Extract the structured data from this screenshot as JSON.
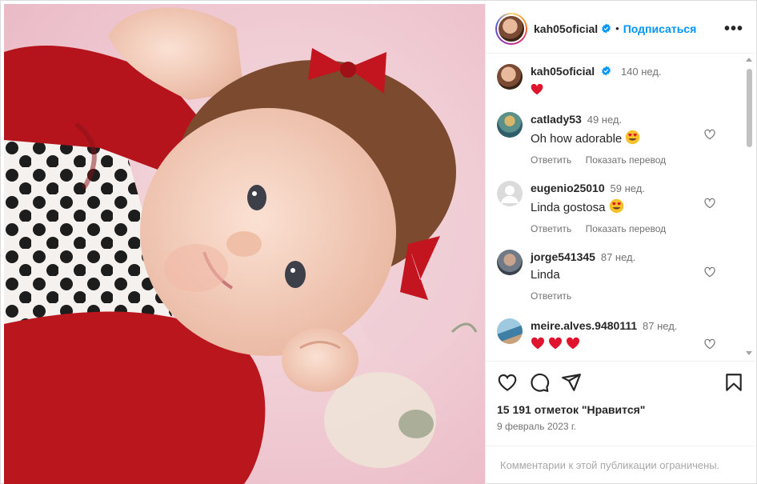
{
  "post": {
    "username": "kah05oficial",
    "follow_label": "Подписаться",
    "dot": "•",
    "more": "•••"
  },
  "caption": {
    "username": "kah05oficial",
    "time": "140 нед."
  },
  "comments": [
    {
      "username": "catlady53",
      "time": "49 нед.",
      "text": "Oh how adorable",
      "reply": "Ответить",
      "translate": "Показать перевод"
    },
    {
      "username": "eugenio25010",
      "time": "59 нед.",
      "text": "Linda gostosa",
      "reply": "Ответить",
      "translate": "Показать перевод"
    },
    {
      "username": "jorge541345",
      "time": "87 нед.",
      "text": "Linda",
      "reply": "Ответить"
    },
    {
      "username": "meire.alves.9480111",
      "time": "87 нед."
    }
  ],
  "likes": "15 191 отметок \"Нравится\"",
  "date": "9 февраль 2023 г.",
  "restricted": "Комментарии к этой публикации ограничены.",
  "icons": {
    "more": "more-horizontal-icon",
    "verified": "verified-badge-icon",
    "like": "heart-icon",
    "comment": "comment-icon",
    "share": "share-icon",
    "save": "bookmark-icon"
  },
  "colors": {
    "accent": "#0095f6",
    "heart": "#ed4956",
    "muted": "#737373"
  }
}
